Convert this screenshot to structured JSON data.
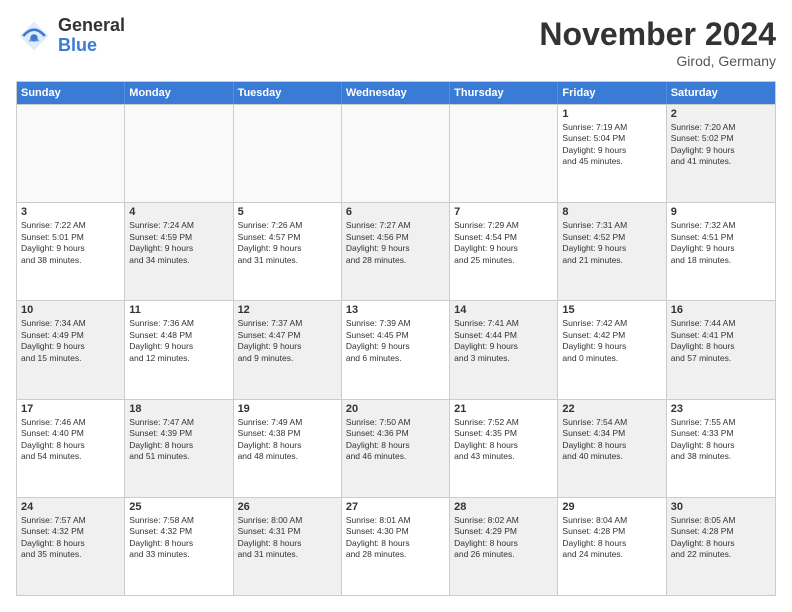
{
  "logo": {
    "general": "General",
    "blue": "Blue"
  },
  "title": "November 2024",
  "location": "Girod, Germany",
  "weekdays": [
    "Sunday",
    "Monday",
    "Tuesday",
    "Wednesday",
    "Thursday",
    "Friday",
    "Saturday"
  ],
  "rows": [
    [
      {
        "day": "",
        "info": "",
        "empty": true
      },
      {
        "day": "",
        "info": "",
        "empty": true
      },
      {
        "day": "",
        "info": "",
        "empty": true
      },
      {
        "day": "",
        "info": "",
        "empty": true
      },
      {
        "day": "",
        "info": "",
        "empty": true
      },
      {
        "day": "1",
        "info": "Sunrise: 7:19 AM\nSunset: 5:04 PM\nDaylight: 9 hours\nand 45 minutes.",
        "empty": false
      },
      {
        "day": "2",
        "info": "Sunrise: 7:20 AM\nSunset: 5:02 PM\nDaylight: 9 hours\nand 41 minutes.",
        "empty": false,
        "shaded": true
      }
    ],
    [
      {
        "day": "3",
        "info": "Sunrise: 7:22 AM\nSunset: 5:01 PM\nDaylight: 9 hours\nand 38 minutes.",
        "empty": false
      },
      {
        "day": "4",
        "info": "Sunrise: 7:24 AM\nSunset: 4:59 PM\nDaylight: 9 hours\nand 34 minutes.",
        "empty": false,
        "shaded": true
      },
      {
        "day": "5",
        "info": "Sunrise: 7:26 AM\nSunset: 4:57 PM\nDaylight: 9 hours\nand 31 minutes.",
        "empty": false
      },
      {
        "day": "6",
        "info": "Sunrise: 7:27 AM\nSunset: 4:56 PM\nDaylight: 9 hours\nand 28 minutes.",
        "empty": false,
        "shaded": true
      },
      {
        "day": "7",
        "info": "Sunrise: 7:29 AM\nSunset: 4:54 PM\nDaylight: 9 hours\nand 25 minutes.",
        "empty": false
      },
      {
        "day": "8",
        "info": "Sunrise: 7:31 AM\nSunset: 4:52 PM\nDaylight: 9 hours\nand 21 minutes.",
        "empty": false,
        "shaded": true
      },
      {
        "day": "9",
        "info": "Sunrise: 7:32 AM\nSunset: 4:51 PM\nDaylight: 9 hours\nand 18 minutes.",
        "empty": false
      }
    ],
    [
      {
        "day": "10",
        "info": "Sunrise: 7:34 AM\nSunset: 4:49 PM\nDaylight: 9 hours\nand 15 minutes.",
        "empty": false,
        "shaded": true
      },
      {
        "day": "11",
        "info": "Sunrise: 7:36 AM\nSunset: 4:48 PM\nDaylight: 9 hours\nand 12 minutes.",
        "empty": false
      },
      {
        "day": "12",
        "info": "Sunrise: 7:37 AM\nSunset: 4:47 PM\nDaylight: 9 hours\nand 9 minutes.",
        "empty": false,
        "shaded": true
      },
      {
        "day": "13",
        "info": "Sunrise: 7:39 AM\nSunset: 4:45 PM\nDaylight: 9 hours\nand 6 minutes.",
        "empty": false
      },
      {
        "day": "14",
        "info": "Sunrise: 7:41 AM\nSunset: 4:44 PM\nDaylight: 9 hours\nand 3 minutes.",
        "empty": false,
        "shaded": true
      },
      {
        "day": "15",
        "info": "Sunrise: 7:42 AM\nSunset: 4:42 PM\nDaylight: 9 hours\nand 0 minutes.",
        "empty": false
      },
      {
        "day": "16",
        "info": "Sunrise: 7:44 AM\nSunset: 4:41 PM\nDaylight: 8 hours\nand 57 minutes.",
        "empty": false,
        "shaded": true
      }
    ],
    [
      {
        "day": "17",
        "info": "Sunrise: 7:46 AM\nSunset: 4:40 PM\nDaylight: 8 hours\nand 54 minutes.",
        "empty": false
      },
      {
        "day": "18",
        "info": "Sunrise: 7:47 AM\nSunset: 4:39 PM\nDaylight: 8 hours\nand 51 minutes.",
        "empty": false,
        "shaded": true
      },
      {
        "day": "19",
        "info": "Sunrise: 7:49 AM\nSunset: 4:38 PM\nDaylight: 8 hours\nand 48 minutes.",
        "empty": false
      },
      {
        "day": "20",
        "info": "Sunrise: 7:50 AM\nSunset: 4:36 PM\nDaylight: 8 hours\nand 46 minutes.",
        "empty": false,
        "shaded": true
      },
      {
        "day": "21",
        "info": "Sunrise: 7:52 AM\nSunset: 4:35 PM\nDaylight: 8 hours\nand 43 minutes.",
        "empty": false
      },
      {
        "day": "22",
        "info": "Sunrise: 7:54 AM\nSunset: 4:34 PM\nDaylight: 8 hours\nand 40 minutes.",
        "empty": false,
        "shaded": true
      },
      {
        "day": "23",
        "info": "Sunrise: 7:55 AM\nSunset: 4:33 PM\nDaylight: 8 hours\nand 38 minutes.",
        "empty": false
      }
    ],
    [
      {
        "day": "24",
        "info": "Sunrise: 7:57 AM\nSunset: 4:32 PM\nDaylight: 8 hours\nand 35 minutes.",
        "empty": false,
        "shaded": true
      },
      {
        "day": "25",
        "info": "Sunrise: 7:58 AM\nSunset: 4:32 PM\nDaylight: 8 hours\nand 33 minutes.",
        "empty": false
      },
      {
        "day": "26",
        "info": "Sunrise: 8:00 AM\nSunset: 4:31 PM\nDaylight: 8 hours\nand 31 minutes.",
        "empty": false,
        "shaded": true
      },
      {
        "day": "27",
        "info": "Sunrise: 8:01 AM\nSunset: 4:30 PM\nDaylight: 8 hours\nand 28 minutes.",
        "empty": false
      },
      {
        "day": "28",
        "info": "Sunrise: 8:02 AM\nSunset: 4:29 PM\nDaylight: 8 hours\nand 26 minutes.",
        "empty": false,
        "shaded": true
      },
      {
        "day": "29",
        "info": "Sunrise: 8:04 AM\nSunset: 4:28 PM\nDaylight: 8 hours\nand 24 minutes.",
        "empty": false
      },
      {
        "day": "30",
        "info": "Sunrise: 8:05 AM\nSunset: 4:28 PM\nDaylight: 8 hours\nand 22 minutes.",
        "empty": false,
        "shaded": true
      }
    ]
  ]
}
